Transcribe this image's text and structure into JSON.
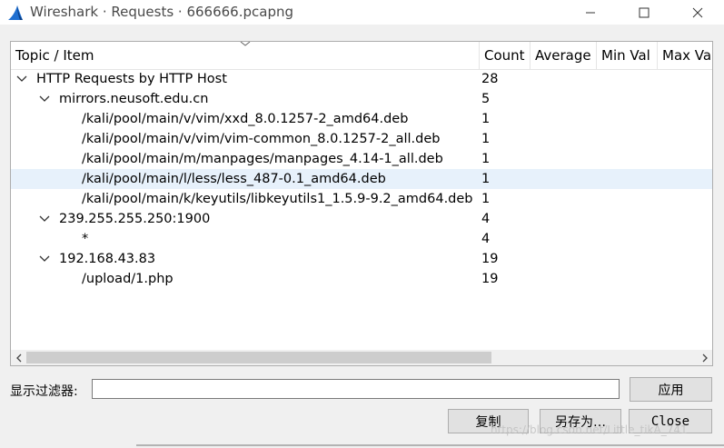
{
  "window": {
    "title": "Wireshark · Requests · 666666.pcapng",
    "controls": [
      "minimize-icon",
      "maximize-icon",
      "close-icon"
    ]
  },
  "table": {
    "columns": [
      "Topic / Item",
      "Count",
      "Average",
      "Min Val",
      "Max Val"
    ],
    "rows": [
      {
        "label": "HTTP Requests by HTTP Host",
        "count": "28",
        "expanded": true
      },
      {
        "label": "mirrors.neusoft.edu.cn",
        "count": "5",
        "expanded": true
      },
      {
        "label": "/kali/pool/main/v/vim/xxd_8.0.1257-2_amd64.deb",
        "count": "1"
      },
      {
        "label": "/kali/pool/main/v/vim/vim-common_8.0.1257-2_all.deb",
        "count": "1"
      },
      {
        "label": "/kali/pool/main/m/manpages/manpages_4.14-1_all.deb",
        "count": "1"
      },
      {
        "label": "/kali/pool/main/l/less/less_487-0.1_amd64.deb",
        "count": "1",
        "highlight": "hover"
      },
      {
        "label": "/kali/pool/main/k/keyutils/libkeyutils1_1.5.9-9.2_amd64.deb",
        "count": "1"
      },
      {
        "label": "239.255.255.250:1900",
        "count": "4",
        "expanded": true
      },
      {
        "label": "*",
        "count": "4"
      },
      {
        "label": "192.168.43.83",
        "count": "19",
        "expanded": true,
        "highlight": "selected"
      },
      {
        "label": "/upload/1.php",
        "count": "19"
      }
    ]
  },
  "filter": {
    "label": "显示过滤器:",
    "value": "",
    "apply_label": "应用"
  },
  "buttons": {
    "copy": "复制",
    "save_as": "另存为…",
    "close": "Close"
  },
  "watermark": "https://blog.csdn.net/Little_tikA_741",
  "colors": {
    "hover_row": "#e7f1fb",
    "selected_row": "#d9d9d9",
    "wireshark_fin": "#1f6fd1"
  }
}
